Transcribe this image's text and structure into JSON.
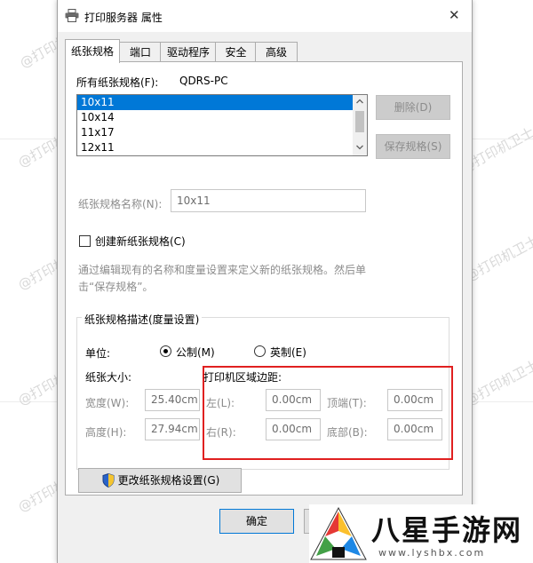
{
  "watermark": {
    "text": "@打印机卫士"
  },
  "branding": {
    "name": "八星手游网",
    "url": "www.lyshbx.com"
  },
  "window": {
    "title": "打印服务器 属性",
    "close_glyph": "✕"
  },
  "tabs": [
    "纸张规格",
    "端口",
    "驱动程序",
    "安全",
    "高级"
  ],
  "forms": {
    "all_label": "所有纸张规格(F):",
    "server_name": "QDRS-PC",
    "list_items": [
      "10x11",
      "10x14",
      "11x17",
      "12x11"
    ],
    "selected_index": 0,
    "delete_button": "删除(D)",
    "save_button": "保存规格(S)",
    "name_label": "纸张规格名称(N):",
    "name_value": "10x11",
    "create_new_label": "创建新纸张规格(C)",
    "create_new_checked": false,
    "description_line1": "通过编辑现有的名称和度量设置来定义新的纸张规格。然后单",
    "description_line2": "击“保存规格”。"
  },
  "measurement": {
    "group_title": "纸张规格描述(度量设置)",
    "unit_label": "单位:",
    "metric_label": "公制(M)",
    "english_label": "英制(E)",
    "selected_unit": "metric",
    "paper_size_title": "纸张大小:",
    "width_label": "宽度(W):",
    "width_value": "25.40cm",
    "height_label": "高度(H):",
    "height_value": "27.94cm",
    "margins_title": "打印机区域边距:",
    "left_label": "左(L):",
    "left_value": "0.00cm",
    "right_label": "右(R):",
    "right_value": "0.00cm",
    "top_label": "顶端(T):",
    "top_value": "0.00cm",
    "bottom_label": "底部(B):",
    "bottom_value": "0.00cm",
    "highlight_color": "#e02020"
  },
  "footer": {
    "change_settings_button": "更改纸张规格设置(G)",
    "ok_button": "确定"
  }
}
